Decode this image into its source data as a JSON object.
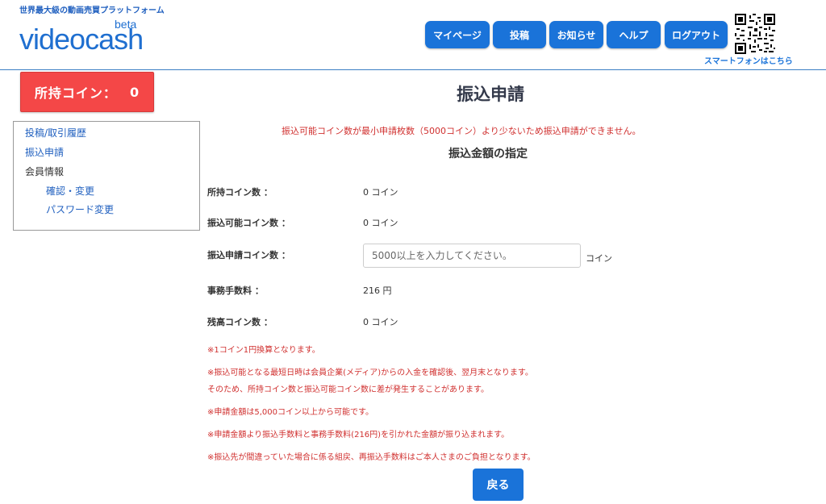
{
  "header": {
    "tagline": "世界最大級の動画売買プラットフォーム",
    "logo_text": "videocash",
    "logo_beta": "beta",
    "nav": [
      "マイページ",
      "投稿",
      "お知らせ",
      "ヘルプ",
      "ログアウト"
    ],
    "smartphone_link": "スマートフォンはこちら",
    "brand_color": "#1a73d9"
  },
  "coin_badge": {
    "label": "所持コイン：",
    "value": "0",
    "color": "#f44747"
  },
  "sidebar": {
    "items": [
      {
        "label": "投稿/取引履歴",
        "link": true
      },
      {
        "label": "振込申請",
        "link": true
      },
      {
        "label": "会員情報",
        "link": false
      },
      {
        "label": "確認・変更",
        "link": true
      },
      {
        "label": "パスワード変更",
        "link": true
      }
    ]
  },
  "main": {
    "title": "振込申請",
    "warning": "振込可能コイン数が最小申請枚数（5000コイン）より少ないため振込申請ができません。",
    "subtitle": "振込金額の指定",
    "rows": [
      {
        "label": "所持コイン数 ：",
        "value": "0 コイン"
      },
      {
        "label": "振込可能コイン数 ：",
        "value": "0 コイン"
      },
      {
        "label": "振込申請コイン数 ：",
        "value": ""
      },
      {
        "label": "事務手数料 ：",
        "value": "216 円"
      },
      {
        "label": "残高コイン数 ：",
        "value": "0 コイン"
      }
    ],
    "input_placeholder": "5000以上を入力してください。",
    "input_unit": "コイン",
    "notes": [
      "※1コイン1円換算となります。",
      "※振込可能となる最短日時は会員企業(メディア)からの入金を確認後、翌月末となります。",
      "そのため、所持コイン数と振込可能コイン数に差が発生することがあります。",
      "※申請金額は5,000コイン以上から可能です。",
      "※申請金額より振込手数料と事務手数料(216円)を引かれた金額が振り込まれます。",
      "※振込先が間違っていた場合に係る組戻、再振込手数料はご本人さまのご負担となります。"
    ],
    "back_button": "戻る",
    "warning_color": "#d0302f"
  }
}
